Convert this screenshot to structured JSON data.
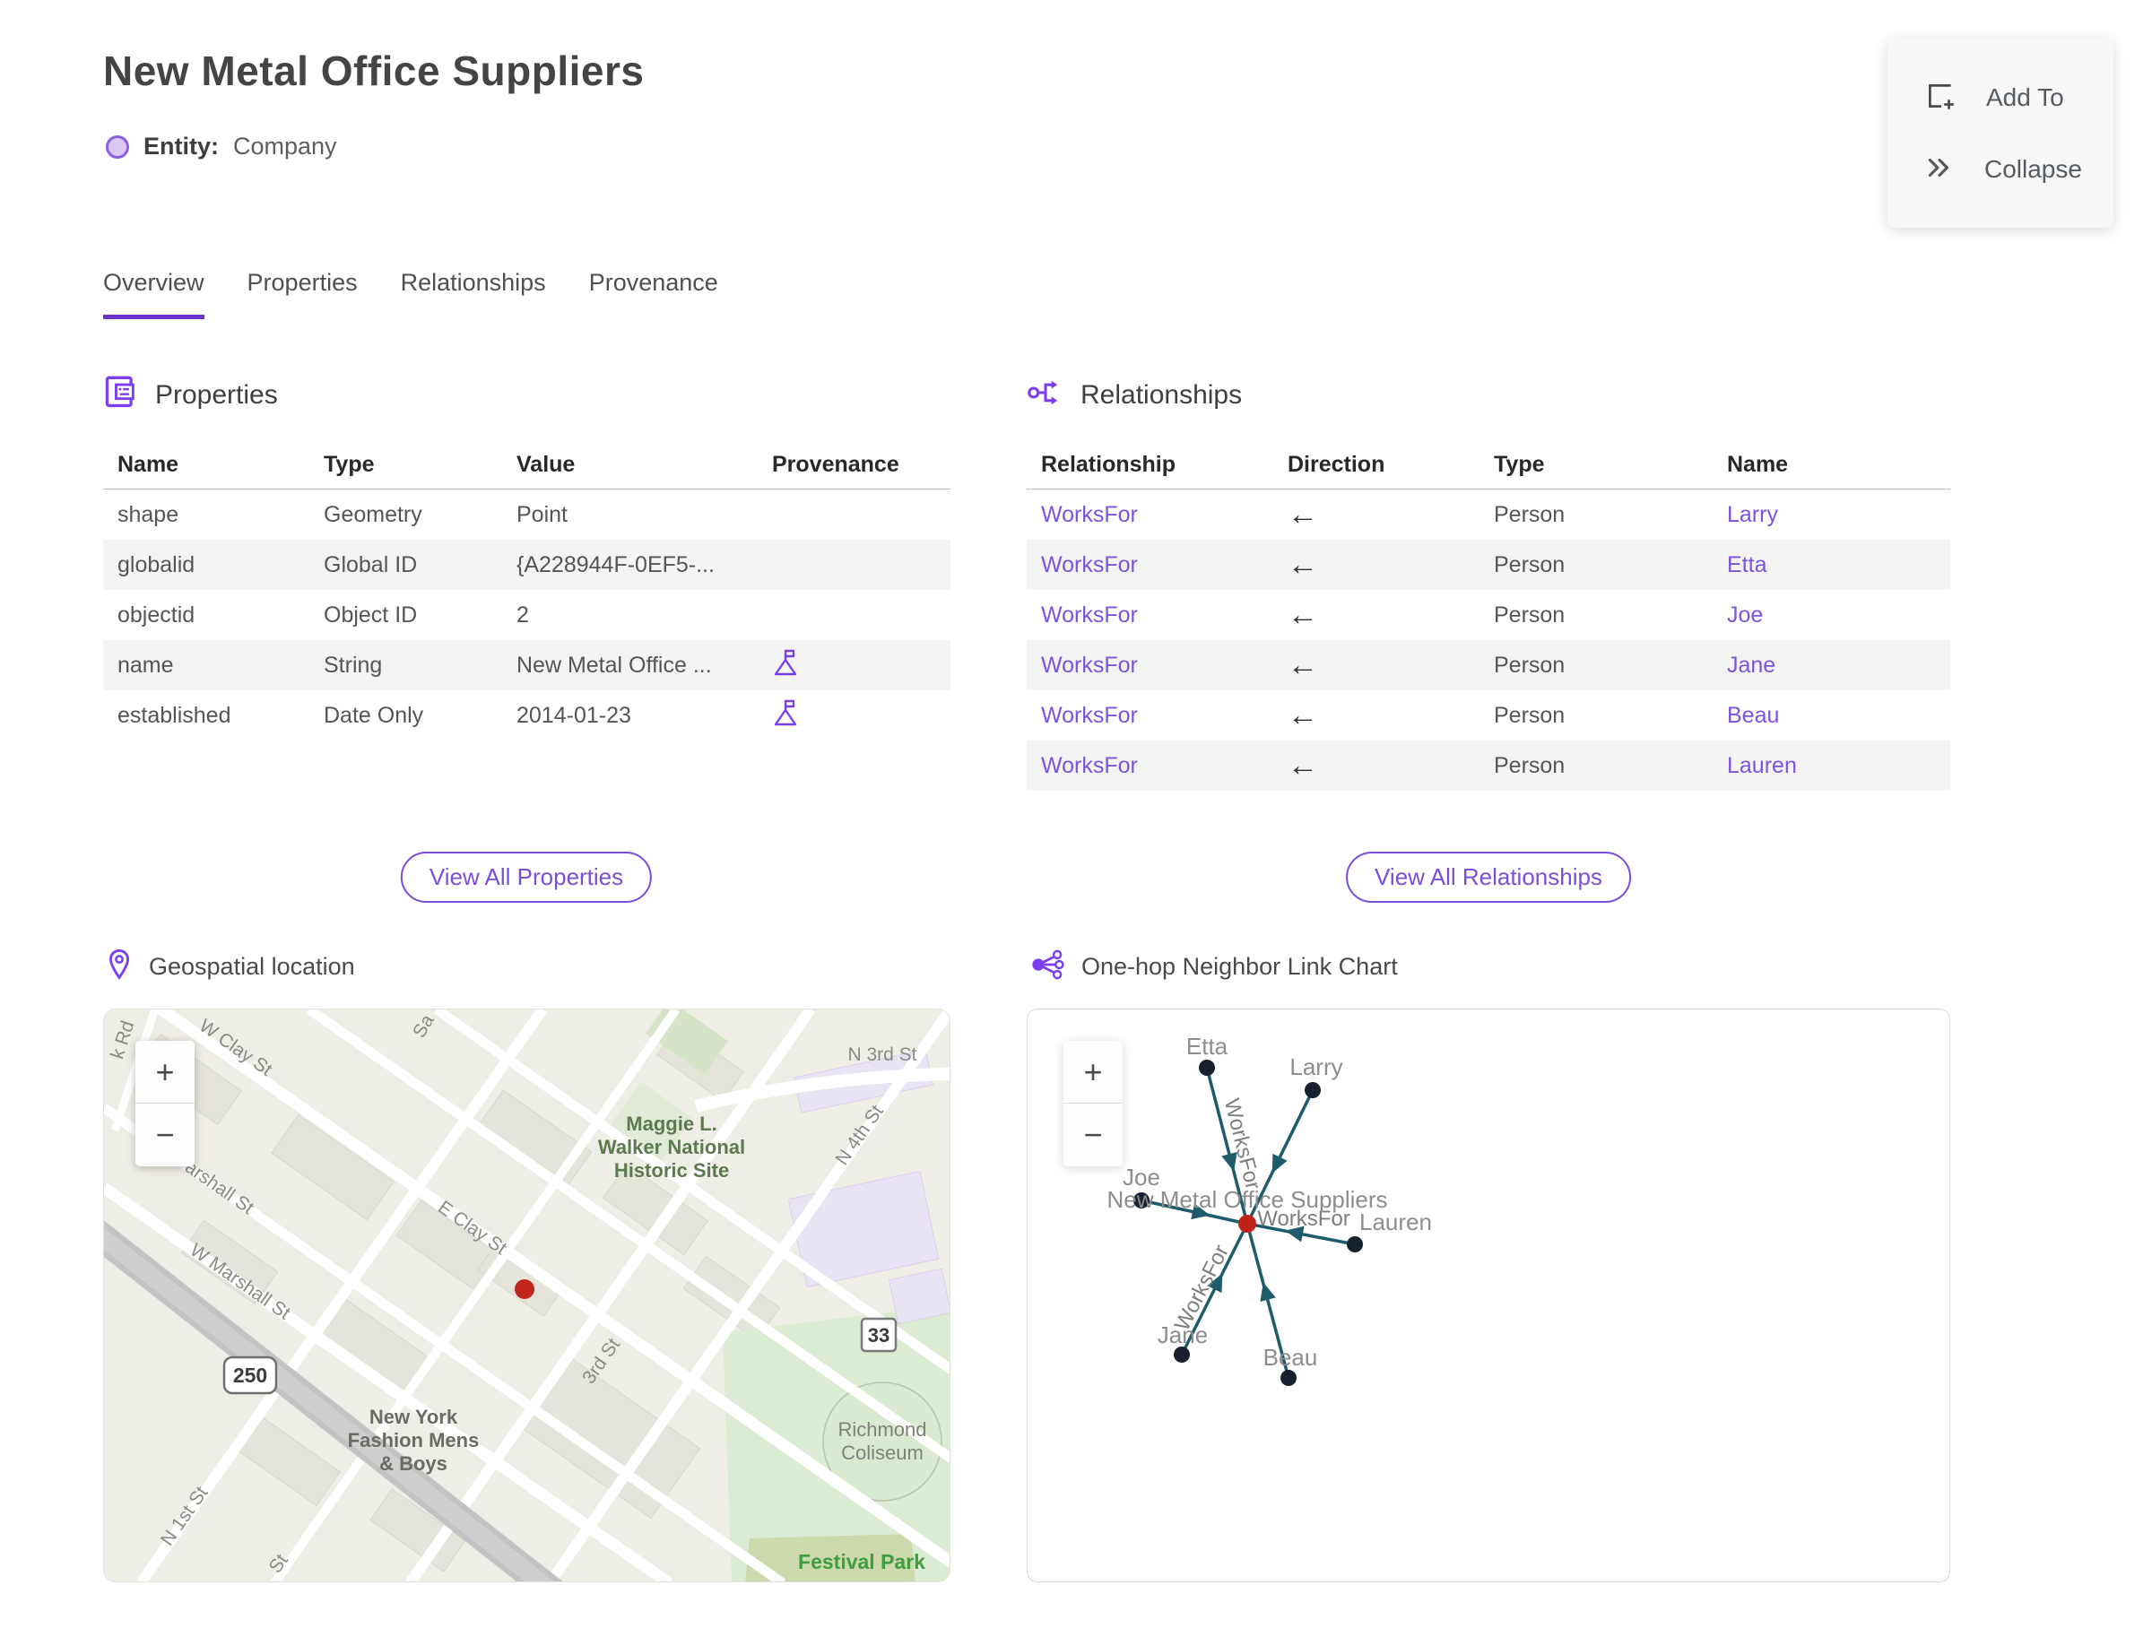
{
  "page": {
    "title": "New Metal Office Suppliers",
    "entity_label": "Entity:",
    "entity_type": "Company"
  },
  "actions": {
    "add_to": "Add To",
    "collapse": "Collapse"
  },
  "tabs": [
    {
      "label": "Overview",
      "active": true
    },
    {
      "label": "Properties",
      "active": false
    },
    {
      "label": "Relationships",
      "active": false
    },
    {
      "label": "Provenance",
      "active": false
    }
  ],
  "properties_section": {
    "title": "Properties",
    "columns": {
      "name": "Name",
      "type": "Type",
      "value": "Value",
      "provenance": "Provenance"
    },
    "rows": [
      {
        "name": "shape",
        "type": "Geometry",
        "value": "Point",
        "has_provenance": false
      },
      {
        "name": "globalid",
        "type": "Global ID",
        "value": "{A228944F-0EF5-...",
        "has_provenance": false
      },
      {
        "name": "objectid",
        "type": "Object ID",
        "value": "2",
        "has_provenance": false
      },
      {
        "name": "name",
        "type": "String",
        "value": "New Metal Office ...",
        "has_provenance": true
      },
      {
        "name": "established",
        "type": "Date Only",
        "value": "2014-01-23",
        "has_provenance": true
      }
    ],
    "view_all_label": "View All Properties"
  },
  "relationships_section": {
    "title": "Relationships",
    "columns": {
      "relationship": "Relationship",
      "direction": "Direction",
      "type": "Type",
      "name": "Name"
    },
    "rows": [
      {
        "relationship": "WorksFor",
        "direction": "←",
        "type": "Person",
        "name": "Larry"
      },
      {
        "relationship": "WorksFor",
        "direction": "←",
        "type": "Person",
        "name": "Etta"
      },
      {
        "relationship": "WorksFor",
        "direction": "←",
        "type": "Person",
        "name": "Joe"
      },
      {
        "relationship": "WorksFor",
        "direction": "←",
        "type": "Person",
        "name": "Jane"
      },
      {
        "relationship": "WorksFor",
        "direction": "←",
        "type": "Person",
        "name": "Beau"
      },
      {
        "relationship": "WorksFor",
        "direction": "←",
        "type": "Person",
        "name": "Lauren"
      }
    ],
    "view_all_label": "View All Relationships"
  },
  "map_section": {
    "title": "Geospatial location",
    "zoom_in": "+",
    "zoom_out": "−",
    "labels": {
      "w_clay": "W Clay St",
      "marshall_partial": "arshall St",
      "w_marshall": "W Marshall St",
      "e_clay": "E Clay St",
      "n_3rd": "N 3rd St",
      "n_4th": "N 4th St",
      "n_1st": "N 1st St",
      "third_st": "3rd St",
      "st_partial": "St",
      "sa_partial": "Sa",
      "k_rd": "k Rd",
      "maggie_1": "Maggie L.",
      "maggie_2": "Walker National",
      "maggie_3": "Historic Site",
      "ny_1": "New York",
      "ny_2": "Fashion Mens",
      "ny_3": "& Boys",
      "richmond_1": "Richmond",
      "richmond_2": "Coliseum",
      "festival_park": "Festival Park",
      "shield_250": "250",
      "shield_33": "33"
    }
  },
  "link_chart_section": {
    "title": "One-hop Neighbor Link Chart",
    "zoom_in": "+",
    "zoom_out": "−",
    "center_label": "New Metal Office Suppliers",
    "edge_label": "WorksFor",
    "nodes": [
      {
        "label": "Etta"
      },
      {
        "label": "Larry"
      },
      {
        "label": "Joe"
      },
      {
        "label": "Lauren"
      },
      {
        "label": "Jane"
      },
      {
        "label": "Beau"
      }
    ]
  },
  "colors": {
    "accent_purple": "#7d52e2",
    "tab_underline": "#6a33cf",
    "entity_fill": "#d9c7f4",
    "entity_border": "#8a5fe3",
    "graph_edge": "#1e5b6b",
    "graph_node": "#16202e",
    "graph_center_node": "#bf2318",
    "map_marker": "#c3271b"
  }
}
